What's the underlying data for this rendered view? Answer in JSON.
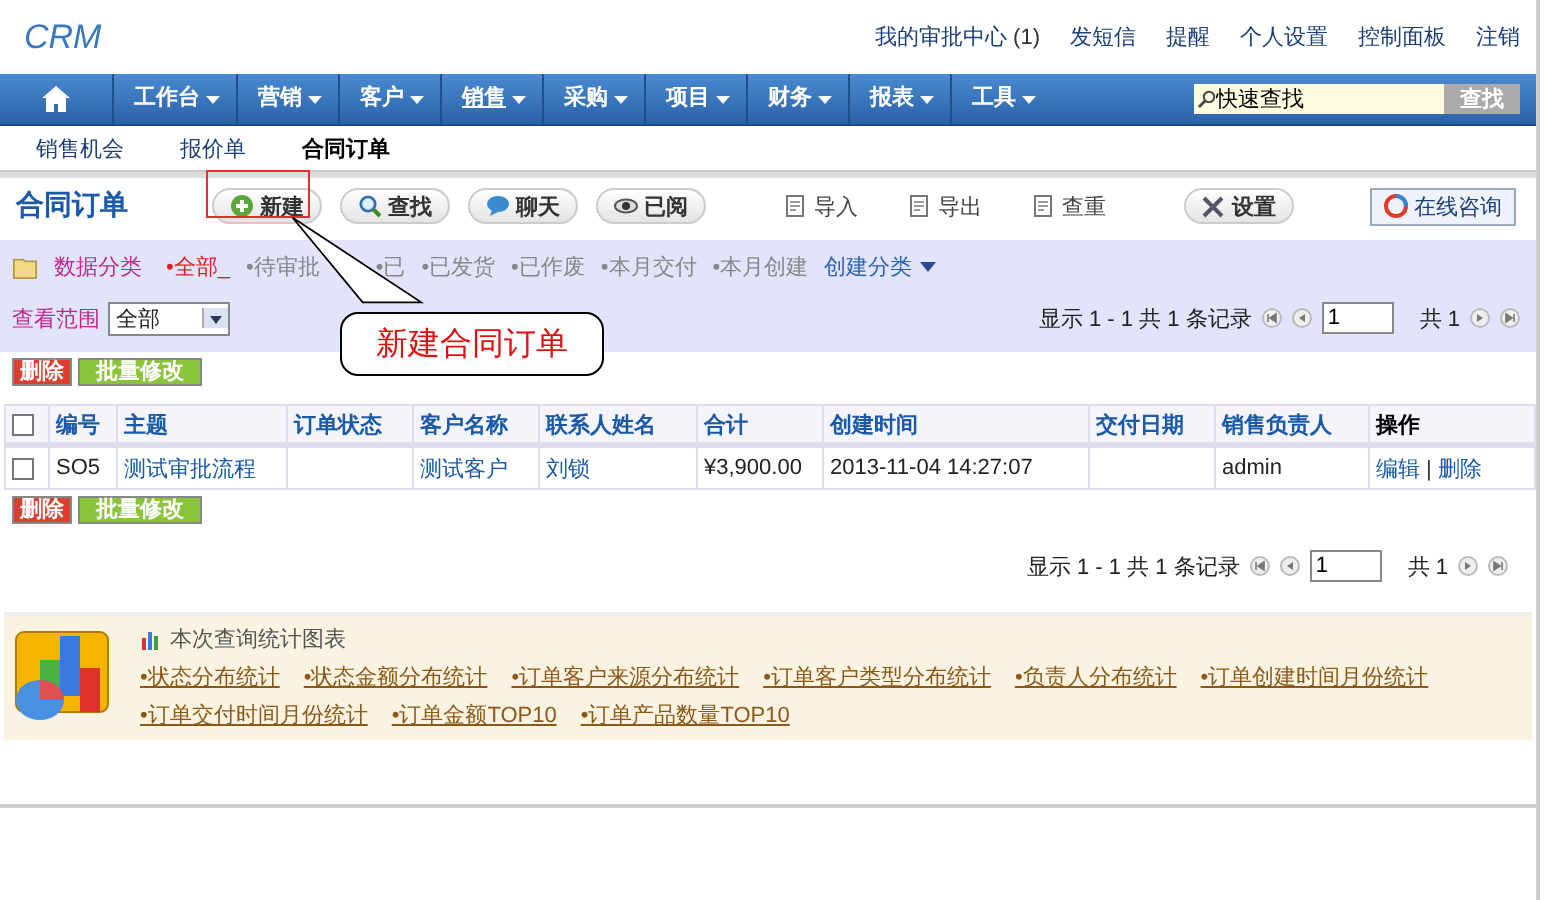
{
  "logo": "CRM",
  "top_links": [
    {
      "label": "我的审批中心",
      "count": "(1)"
    },
    {
      "label": "发短信"
    },
    {
      "label": "提醒"
    },
    {
      "label": "个人设置"
    },
    {
      "label": "控制面板"
    },
    {
      "label": "注销"
    }
  ],
  "nav": [
    {
      "label": "工作台",
      "selected": false
    },
    {
      "label": "营销",
      "selected": false
    },
    {
      "label": "客户",
      "selected": false
    },
    {
      "label": "销售",
      "selected": true
    },
    {
      "label": "采购",
      "selected": false
    },
    {
      "label": "项目",
      "selected": false
    },
    {
      "label": "财务",
      "selected": false
    },
    {
      "label": "报表",
      "selected": false
    },
    {
      "label": "工具",
      "selected": false
    }
  ],
  "search": {
    "value": "快速查找",
    "button": "查找"
  },
  "subnav": [
    {
      "label": "销售机会",
      "selected": false
    },
    {
      "label": "报价单",
      "selected": false
    },
    {
      "label": "合同订单",
      "selected": true
    }
  ],
  "page_title": "合同订单",
  "toolbar": [
    {
      "label": "新建",
      "kind": "pill"
    },
    {
      "label": "查找",
      "kind": "pill"
    },
    {
      "label": "聊天",
      "kind": "pill"
    },
    {
      "label": "已阅",
      "kind": "pill"
    },
    {
      "label": "导入",
      "kind": "plain"
    },
    {
      "label": "导出",
      "kind": "plain"
    },
    {
      "label": "查重",
      "kind": "plain"
    },
    {
      "label": "设置",
      "kind": "pill"
    }
  ],
  "consult_button": "在线咨询",
  "filter": {
    "label": "数据分类",
    "items": [
      {
        "label": "•全部_",
        "selected": true
      },
      {
        "label": "•待审批",
        "selected": false
      },
      {
        "label": "•已",
        "selected": false
      },
      {
        "label": "•已发货",
        "selected": false
      },
      {
        "label": "•已作废",
        "selected": false
      },
      {
        "label": "•本月交付",
        "selected": false
      },
      {
        "label": "•本月创建",
        "selected": false
      }
    ],
    "create": "创建分类"
  },
  "scope": {
    "label": "查看范围",
    "value": "全部"
  },
  "pagination_top": {
    "summary": "显示 1 - 1 共 1 条记录",
    "page": "1",
    "total": "共 1"
  },
  "actions_top": [
    "删除",
    "批量修改"
  ],
  "table": {
    "select_all_checked": false,
    "columns": [
      "编号",
      "主题",
      "订单状态",
      "客户名称",
      "联系人姓名",
      "合计",
      "创建时间",
      "交付日期",
      "销售负责人",
      "操作"
    ],
    "rows": [
      {
        "checked": false,
        "cells": [
          "SO5",
          "测试审批流程",
          "",
          "测试客户",
          "刘锁",
          "¥3,900.00",
          "2013-11-04 14:27:07",
          "",
          "admin"
        ],
        "actions": [
          "编辑",
          "删除"
        ],
        "action_separator": "|"
      }
    ]
  },
  "actions_bottom": [
    "删除",
    "批量修改"
  ],
  "pagination_bottom": {
    "summary": "显示 1 - 1 共 1 条记录",
    "page": "1",
    "total": "共 1"
  },
  "stats": {
    "title": "本次查询统计图表",
    "links": [
      "•状态分布统计",
      "•状态金额分布统计",
      "•订单客户来源分布统计",
      "•订单客户类型分布统计",
      "•负责人分布统计",
      "•订单创建时间月份统计",
      "•订单交付时间月份统计",
      "•订单金额TOP10",
      "•订单产品数量TOP10"
    ]
  },
  "callout": {
    "text": "新建合同订单"
  }
}
